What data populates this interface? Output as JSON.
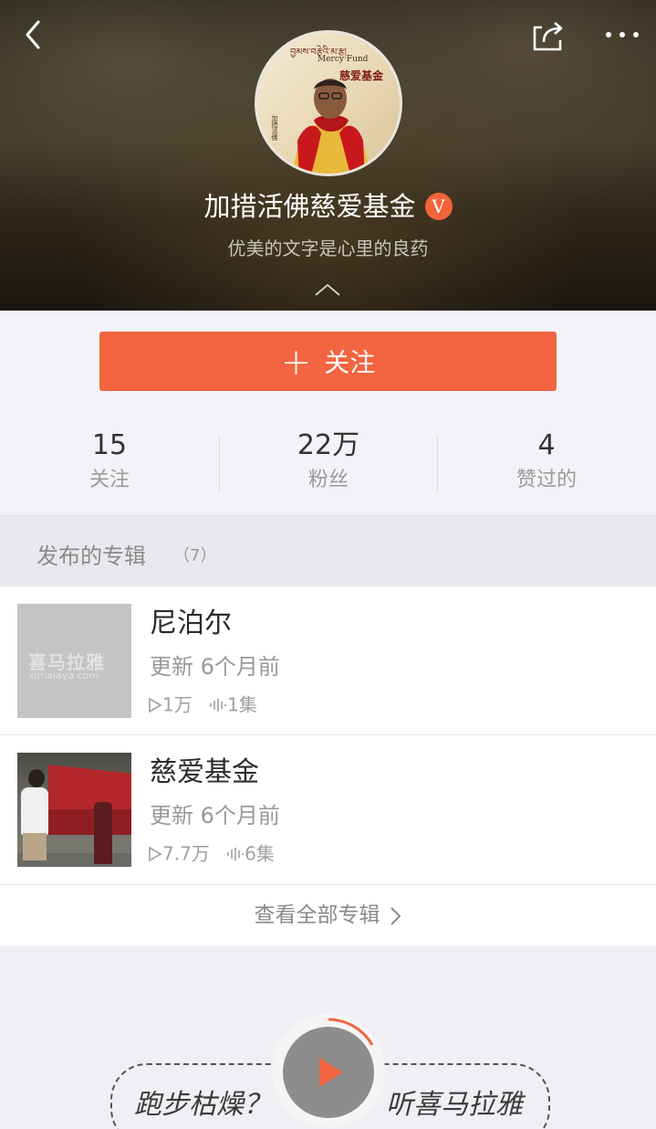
{
  "profile": {
    "name": "加措活佛慈爱基金",
    "verified_mark": "V",
    "bio": "优美的文字是心里的良药",
    "avatar_logo_tibetan": "བྱམས་བརྩེའི་མ་རྩ།",
    "avatar_logo_en": "Mercy Fund",
    "avatar_logo_cn": "慈爱基金",
    "avatar_side_cn": "加措活佛"
  },
  "actions": {
    "follow_plus": "+",
    "follow_label": "关注"
  },
  "stats": [
    {
      "value": "15",
      "label": "关注"
    },
    {
      "value": "22万",
      "label": "粉丝"
    },
    {
      "value": "4",
      "label": "赞过的"
    }
  ],
  "albums_section": {
    "title": "发布的专辑",
    "count": "（7）",
    "view_all": "查看全部专辑"
  },
  "albums": [
    {
      "title": "尼泊尔",
      "updated": "更新 6个月前",
      "plays": "1万",
      "episodes": "1集",
      "cover_watermark": "喜马拉雅",
      "cover_watermark_url": "ximalaya.com"
    },
    {
      "title": "慈爱基金",
      "updated": "更新 6个月前",
      "plays": "7.7万",
      "episodes": "6集"
    }
  ],
  "promo": {
    "left_text": "跑步枯燥？",
    "right_text": "听喜马拉雅"
  },
  "colors": {
    "accent": "#f36440",
    "badge": "#f2643a",
    "page_bg": "#f0eff4"
  },
  "icons": [
    "back-icon",
    "share-icon",
    "more-icon",
    "collapse-chevron-icon",
    "plus-icon",
    "play-count-icon",
    "episodes-icon",
    "chevron-right-icon",
    "play-icon"
  ]
}
